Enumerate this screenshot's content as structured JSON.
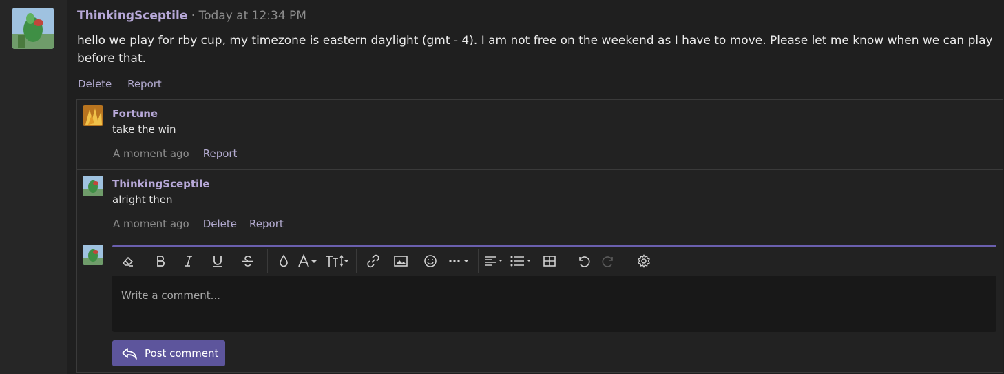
{
  "post": {
    "author": "ThinkingSceptile",
    "separator": " · ",
    "timestamp": "Today at 12:34 PM",
    "body": "hello we play for rby cup, my timezone is eastern daylight (gmt - 4). I am not free on the weekend as I have to move. Please let me know when we can play before that.",
    "actions": {
      "delete": "Delete",
      "report": "Report"
    }
  },
  "comments": [
    {
      "author": "Fortune",
      "text": "take the win",
      "time": "A moment ago",
      "report": "Report"
    },
    {
      "author": "ThinkingSceptile",
      "text": "alright then",
      "time": "A moment ago",
      "delete": "Delete",
      "report": "Report"
    }
  ],
  "editor": {
    "placeholder": "Write a comment...",
    "submit_label": "Post comment",
    "toolbar_icons": [
      "eraser-icon",
      "bold-icon",
      "italic-icon",
      "underline-icon",
      "strikethrough-icon",
      "color-drop-icon",
      "font-color-icon",
      "font-size-icon",
      "link-icon",
      "image-icon",
      "emoji-icon",
      "more-icon",
      "align-icon",
      "list-icon",
      "table-icon",
      "undo-icon",
      "redo-icon",
      "settings-icon"
    ]
  },
  "colors": {
    "accent": "#6a5fae",
    "username": "#b7a8d8",
    "button": "#5d559c"
  }
}
